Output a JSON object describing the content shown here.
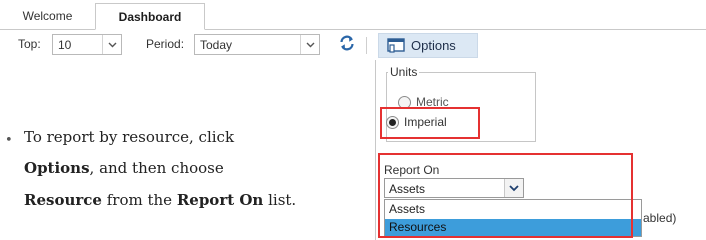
{
  "tabs": [
    {
      "label": "Welcome",
      "active": false
    },
    {
      "label": "Dashboard",
      "active": true
    }
  ],
  "toolbar": {
    "top_label": "Top:",
    "top_value": "10",
    "period_label": "Period:",
    "period_value": "Today",
    "refresh_icon": "refresh-arrows-icon",
    "options_icon": "window-options-icon",
    "options_label": "Options"
  },
  "options_panel": {
    "units_title": "Units",
    "units": [
      {
        "label": "Metric",
        "selected": false
      },
      {
        "label": "Imperial",
        "selected": true
      }
    ],
    "report_on_label": "Report On",
    "report_on_value": "Assets",
    "report_on_options": [
      {
        "label": "Assets",
        "highlighted": false
      },
      {
        "label": "Resources",
        "highlighted": true
      }
    ],
    "obscured_text": "abled)"
  },
  "instructions": {
    "bullet": "•",
    "line1": "To report by resource, click",
    "line2_bold": "Options",
    "line2_rest": ", and then choose",
    "line3_bold1": "Resource",
    "line3_mid": " from the ",
    "line3_bold2": "Report On",
    "line3_end": " list."
  },
  "colors": {
    "highlight_box": "#e53131",
    "options_button_bg": "#dce8f4",
    "selected_list_item": "#3d9ddb",
    "refresh_icon": "#2a66a8"
  }
}
